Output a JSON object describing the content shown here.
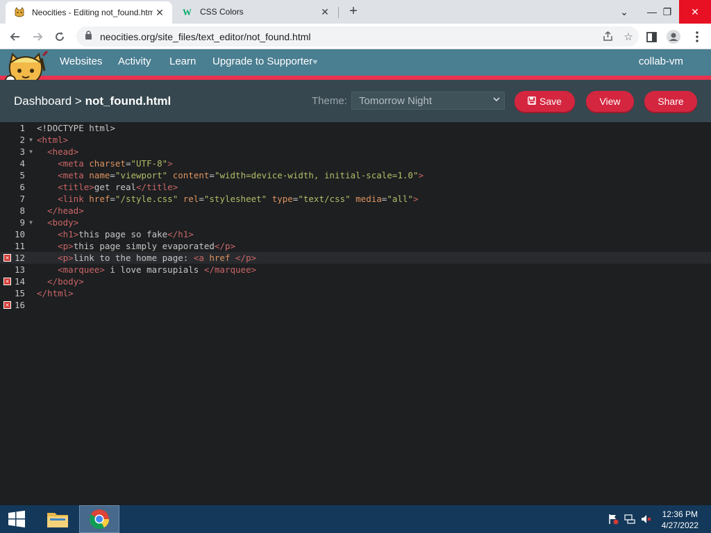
{
  "browser": {
    "tabs": [
      {
        "title": "Neocities - Editing not_found.html",
        "favicon": "neocities-cat-icon",
        "active": true
      },
      {
        "title": "CSS Colors",
        "favicon": "w3schools-icon",
        "active": false
      }
    ],
    "new_tab": "+",
    "window_controls": {
      "minimize": "—",
      "restore": "❐",
      "close": "✕",
      "tab_search": "⌄"
    },
    "url": "neocities.org/site_files/text_editor/not_found.html"
  },
  "site_nav": {
    "links": [
      "Websites",
      "Activity",
      "Learn",
      "Upgrade to Supporter"
    ],
    "supporter_icon": "♥",
    "user": "collab-vm"
  },
  "editor_bar": {
    "breadcrumb_root": "Dashboard",
    "breadcrumb_sep": ">",
    "filename": "not_found.html",
    "theme_label": "Theme:",
    "theme_value": "Tomorrow Night",
    "save_label": "Save",
    "view_label": "View",
    "share_label": "Share"
  },
  "code": {
    "line_numbers": [
      "1",
      "2",
      "3",
      "4",
      "5",
      "6",
      "7",
      "8",
      "9",
      "10",
      "11",
      "12",
      "13",
      "14",
      "15",
      "16"
    ],
    "error_lines": [
      12,
      14,
      16
    ],
    "active_line": 12,
    "lines": [
      "<!DOCTYPE html>",
      "<html>",
      "  <head>",
      "    <meta charset=\"UTF-8\">",
      "    <meta name=\"viewport\" content=\"width=device-width, initial-scale=1.0\">",
      "    <title>get real</title>",
      "    <link href=\"/style.css\" rel=\"stylesheet\" type=\"text/css\" media=\"all\">",
      "  </head>",
      "  <body>",
      "    <h1>this page so fake</h1>",
      "    <p>this page simply evaporated</p>",
      "    <p>link to the home page: <a href </p>",
      "    <marquee> i love marsupials </marquee>",
      "  </body>",
      "</html>",
      ""
    ]
  },
  "taskbar": {
    "time": "12:36 PM",
    "date": "4/27/2022"
  },
  "colors": {
    "nav_bg": "#4a7e91",
    "accent_red": "#e93250",
    "button_red": "#d4263f",
    "editor_bg": "#1d1f21",
    "taskbar_bg": "#13385a"
  }
}
